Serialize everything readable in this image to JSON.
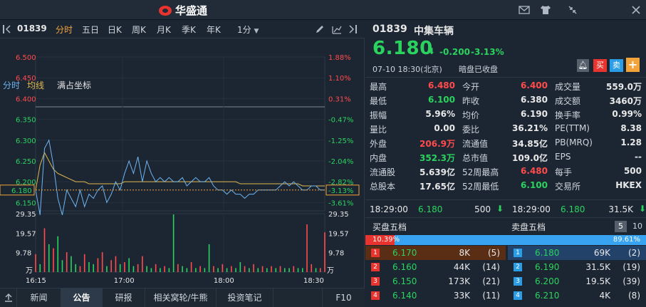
{
  "app": {
    "brand": "华盛通"
  },
  "window_controls": [
    "mail-icon",
    "shirt-icon",
    "shrink-icon",
    "close-icon"
  ],
  "toolbar": {
    "code": "01839",
    "tabs": [
      "分时",
      "五日",
      "日K",
      "周K",
      "月K",
      "季K",
      "年K",
      "1分"
    ],
    "active_tab": "分时"
  },
  "subbar": {
    "fenshi": "分时",
    "junxian": "均线",
    "mode": "满占坐标"
  },
  "price_axis_left": [
    "6.500",
    "6.450",
    "6.400",
    "6.350",
    "6.300",
    "6.250",
    "6.200",
    "6.150"
  ],
  "price_axis_right": [
    "1.88%",
    "1.10%",
    "0.31%",
    "-0.47%",
    "-1.25%",
    "-2.04%",
    "-2.82%",
    "-3.61%"
  ],
  "current_price_tag": "6.180",
  "current_pct_tag": "-3.13%",
  "volume_axis_left": [
    "29.35",
    "19.57",
    "9.78",
    "万"
  ],
  "volume_axis_right": [
    "29.35",
    "19.57",
    "9.78",
    "万"
  ],
  "time_axis": [
    "16:15",
    "17:00",
    "18:00",
    "18:30"
  ],
  "bottom_tabs": [
    "新闻",
    "公告",
    "研报",
    "相关窝轮/牛熊",
    "投资笔记",
    "F10"
  ],
  "bottom_active": "公告",
  "stock": {
    "code": "01839",
    "name": "中集车辆",
    "price": "6.180",
    "change": "-0.200",
    "pct": "-3.13%",
    "time": "07-10  18:30(北京)",
    "status": "暗盘已收盘",
    "buy": "买",
    "sell": "卖",
    "add": "+"
  },
  "stats": [
    [
      {
        "l": "最高",
        "v": "6.480",
        "c": "red"
      },
      {
        "l": "今开",
        "v": "6.400",
        "c": "red"
      },
      {
        "l": "成交量",
        "v": "559.0万",
        "c": "wht"
      }
    ],
    [
      {
        "l": "最低",
        "v": "6.100",
        "c": "grn"
      },
      {
        "l": "昨收",
        "v": "6.380",
        "c": "wht"
      },
      {
        "l": "成交额",
        "v": "3460万",
        "c": "wht"
      }
    ],
    [
      {
        "l": "振幅",
        "v": "5.96%",
        "c": "wht"
      },
      {
        "l": "均价",
        "v": "6.190",
        "c": "wht"
      },
      {
        "l": "换手率",
        "v": "0.99%",
        "c": "wht"
      }
    ],
    [
      {
        "l": "量比",
        "v": "0.00",
        "c": "wht"
      },
      {
        "l": "委比",
        "v": "36.21%",
        "c": "wht"
      },
      {
        "l": "PE(TTM)",
        "v": "8.38",
        "c": "wht"
      }
    ],
    [
      {
        "l": "外盘",
        "v": "206.9万",
        "c": "red"
      },
      {
        "l": "流通值",
        "v": "34.85亿",
        "c": "wht"
      },
      {
        "l": "PB(MRQ)",
        "v": "1.28",
        "c": "wht"
      }
    ],
    [
      {
        "l": "内盘",
        "v": "352.3万",
        "c": "grn"
      },
      {
        "l": "总市值",
        "v": "109.0亿",
        "c": "wht"
      },
      {
        "l": "EPS",
        "v": "--",
        "c": "wht"
      }
    ],
    [
      {
        "l": "流通股",
        "v": "5.639亿",
        "c": "wht"
      },
      {
        "l": "52周最高",
        "v": "6.480",
        "c": "red"
      },
      {
        "l": "每手",
        "v": "500",
        "c": "wht"
      }
    ],
    [
      {
        "l": "总股本",
        "v": "17.65亿",
        "c": "wht"
      },
      {
        "l": "52周最低",
        "v": "6.100",
        "c": "grn"
      },
      {
        "l": "交易所",
        "v": "HKEX",
        "c": "wht"
      }
    ]
  ],
  "ticks": [
    {
      "time": "18:29:00",
      "price": "6.180",
      "vol": "500"
    },
    {
      "time": "18:29:00",
      "price": "6.180",
      "vol": "31.5K"
    }
  ],
  "orderbook": {
    "buy_title": "买盘五档",
    "sell_title": "卖盘五档",
    "depth_options": [
      "5",
      "10"
    ],
    "buy_pct": "10.39%",
    "sell_pct": "89.61%",
    "buy_ratio": 0.1039,
    "bids": [
      {
        "n": "1",
        "p": "6.170",
        "v": "8K",
        "c": "(5)"
      },
      {
        "n": "2",
        "p": "6.160",
        "v": "44K",
        "c": "(14)"
      },
      {
        "n": "3",
        "p": "6.150",
        "v": "173K",
        "c": "(21)"
      },
      {
        "n": "4",
        "p": "6.140",
        "v": "33K",
        "c": "(11)"
      }
    ],
    "asks": [
      {
        "n": "1",
        "p": "6.180",
        "v": "69K",
        "c": "(2)"
      },
      {
        "n": "2",
        "p": "6.190",
        "v": "31.5K",
        "c": "(19)"
      },
      {
        "n": "3",
        "p": "6.200",
        "v": "19.5K",
        "c": "(39)"
      },
      {
        "n": "4",
        "p": "6.210",
        "v": "4K",
        "c": "(8)"
      }
    ]
  },
  "colors": {
    "up": "#ff4b4b",
    "down": "#2bd35e",
    "price_line": "#6fb4f0",
    "avg_line": "#e3b94f",
    "accent": "#f2a33a"
  },
  "chart_data": {
    "type": "line",
    "x_ticks": [
      "16:15",
      "17:00",
      "18:00",
      "18:30"
    ],
    "ylim": [
      6.13,
      6.5
    ],
    "prev_close": 6.38,
    "series": [
      {
        "values": [
          6.18,
          6.12,
          6.28,
          6.3,
          6.24,
          6.16,
          6.12,
          6.18,
          6.16,
          6.14,
          6.18,
          6.14,
          6.17,
          6.16,
          6.18,
          6.19,
          6.15,
          6.17,
          6.2,
          6.18,
          6.22,
          6.25,
          6.22,
          6.26,
          6.2,
          6.25,
          6.22,
          6.2,
          6.21,
          6.2,
          6.21,
          6.2,
          6.2,
          6.21,
          6.19,
          6.2,
          6.21,
          6.2,
          6.2,
          6.21,
          6.19,
          6.18,
          6.18,
          6.17,
          6.18,
          6.17,
          6.17,
          6.16,
          6.17,
          6.17,
          6.18,
          6.18,
          6.18,
          6.18,
          6.18,
          6.19,
          6.2,
          6.19,
          6.2,
          6.19,
          6.18,
          6.18,
          6.19,
          6.19,
          6.18,
          6.18
        ]
      },
      {
        "values": [
          6.18,
          6.24,
          6.27,
          6.25,
          6.23,
          6.22,
          6.215,
          6.21,
          6.205,
          6.2,
          6.2,
          6.2,
          6.195,
          6.195,
          6.195,
          6.195,
          6.195,
          6.195,
          6.195,
          6.195,
          6.2,
          6.2,
          6.2,
          6.2,
          6.2,
          6.2,
          6.2,
          6.2,
          6.2,
          6.2,
          6.2,
          6.2,
          6.2,
          6.2,
          6.2,
          6.2,
          6.2,
          6.2,
          6.2,
          6.2,
          6.2,
          6.2,
          6.2,
          6.2,
          6.2,
          6.2,
          6.195,
          6.195,
          6.195,
          6.195,
          6.195,
          6.195,
          6.195,
          6.195,
          6.195,
          6.195,
          6.195,
          6.195,
          6.195,
          6.195,
          6.19,
          6.19,
          6.19,
          6.19,
          6.19,
          6.19
        ]
      }
    ],
    "volume": [
      9,
      4,
      22,
      14,
      12,
      18,
      6,
      10,
      8,
      4,
      3,
      9,
      5,
      4,
      7,
      10,
      3,
      6,
      8,
      4,
      5,
      7,
      3,
      4,
      8,
      3,
      2,
      4,
      2,
      3,
      2,
      29,
      4,
      3,
      2,
      5,
      2,
      3,
      2,
      14,
      3,
      2,
      4,
      2,
      3,
      2,
      5,
      3,
      2,
      4,
      2,
      3,
      2,
      3,
      2,
      3,
      2,
      2,
      3,
      2,
      2,
      24,
      4,
      2,
      2,
      20
    ],
    "volume_up": [
      1,
      0,
      1,
      0,
      1,
      0,
      0,
      1,
      0,
      0,
      1,
      1,
      0,
      0,
      1,
      1,
      0,
      1,
      1,
      0,
      1,
      0,
      0,
      1,
      1,
      0,
      0,
      1,
      0,
      1,
      0,
      0,
      1,
      0,
      0,
      1,
      0,
      1,
      0,
      0,
      1,
      0,
      1,
      0,
      1,
      0,
      0,
      1,
      0,
      1,
      0,
      1,
      0,
      1,
      0,
      1,
      0,
      0,
      1,
      0,
      0,
      1,
      1,
      0,
      1,
      1
    ],
    "volume_ylim": [
      0,
      29.35
    ]
  }
}
